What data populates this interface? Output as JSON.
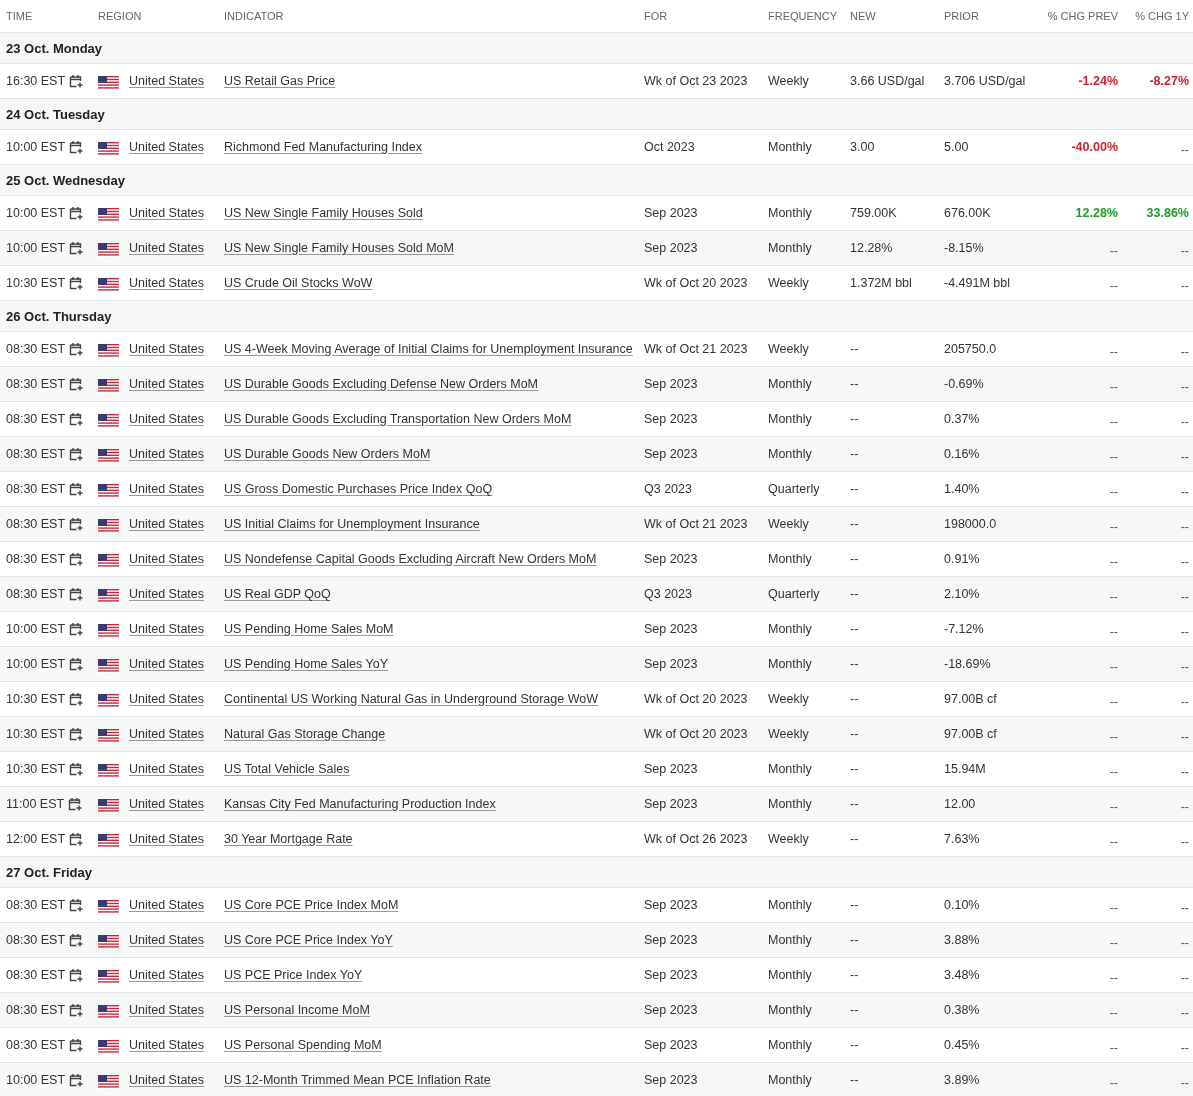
{
  "columns": [
    "TIME",
    "REGION",
    "INDICATOR",
    "FOR",
    "FREQUENCY",
    "NEW",
    "PRIOR",
    "% CHG PREV",
    "% CHG 1Y"
  ],
  "days": [
    {
      "label": "23 Oct. Monday",
      "events": [
        {
          "time": "16:30 EST",
          "region": "United States",
          "indicator": "US Retail Gas Price",
          "for": "Wk of Oct 23 2023",
          "frequency": "Weekly",
          "new": "3.66 USD/gal",
          "prior": "3.706 USD/gal",
          "chg_prev": {
            "text": "-1.24%",
            "color": "#d0202e"
          },
          "chg_1y": {
            "text": "-8.27%",
            "color": "#d0202e"
          }
        }
      ]
    },
    {
      "label": "24 Oct. Tuesday",
      "events": [
        {
          "time": "10:00 EST",
          "region": "United States",
          "indicator": "Richmond Fed Manufacturing Index",
          "for": "Oct 2023",
          "frequency": "Monthly",
          "new": "3.00",
          "prior": "5.00",
          "chg_prev": {
            "text": "-40.00%",
            "color": "#d0202e"
          },
          "chg_1y": {
            "text": "--"
          }
        }
      ]
    },
    {
      "label": "25 Oct. Wednesday",
      "events": [
        {
          "time": "10:00 EST",
          "region": "United States",
          "indicator": "US New Single Family Houses Sold",
          "for": "Sep 2023",
          "frequency": "Monthly",
          "new": "759.00K",
          "prior": "676.00K",
          "chg_prev": {
            "text": "12.28%",
            "color": "#1f9d2a"
          },
          "chg_1y": {
            "text": "33.86%",
            "color": "#1f9d2a"
          }
        },
        {
          "time": "10:00 EST",
          "region": "United States",
          "indicator": "US New Single Family Houses Sold MoM",
          "for": "Sep 2023",
          "frequency": "Monthly",
          "new": "12.28%",
          "prior": "-8.15%",
          "chg_prev": {
            "text": "--"
          },
          "chg_1y": {
            "text": "--"
          }
        },
        {
          "time": "10:30 EST",
          "region": "United States",
          "indicator": "US Crude Oil Stocks WoW",
          "for": "Wk of Oct 20 2023",
          "frequency": "Weekly",
          "new": "1.372M bbl",
          "prior": "-4.491M bbl",
          "chg_prev": {
            "text": "--"
          },
          "chg_1y": {
            "text": "--"
          }
        }
      ]
    },
    {
      "label": "26 Oct. Thursday",
      "events": [
        {
          "time": "08:30 EST",
          "region": "United States",
          "indicator": "US 4-Week Moving Average of Initial Claims for Unemployment Insurance",
          "for": "Wk of Oct 21 2023",
          "frequency": "Weekly",
          "new": "--",
          "prior": "205750.0",
          "chg_prev": {
            "text": "--"
          },
          "chg_1y": {
            "text": "--"
          }
        },
        {
          "time": "08:30 EST",
          "region": "United States",
          "indicator": "US Durable Goods Excluding Defense New Orders MoM",
          "for": "Sep 2023",
          "frequency": "Monthly",
          "new": "--",
          "prior": "-0.69%",
          "chg_prev": {
            "text": "--"
          },
          "chg_1y": {
            "text": "--"
          }
        },
        {
          "time": "08:30 EST",
          "region": "United States",
          "indicator": "US Durable Goods Excluding Transportation New Orders MoM",
          "for": "Sep 2023",
          "frequency": "Monthly",
          "new": "--",
          "prior": "0.37%",
          "chg_prev": {
            "text": "--"
          },
          "chg_1y": {
            "text": "--"
          }
        },
        {
          "time": "08:30 EST",
          "region": "United States",
          "indicator": "US Durable Goods New Orders MoM",
          "for": "Sep 2023",
          "frequency": "Monthly",
          "new": "--",
          "prior": "0.16%",
          "chg_prev": {
            "text": "--"
          },
          "chg_1y": {
            "text": "--"
          }
        },
        {
          "time": "08:30 EST",
          "region": "United States",
          "indicator": "US Gross Domestic Purchases Price Index QoQ",
          "for": "Q3 2023",
          "frequency": "Quarterly",
          "new": "--",
          "prior": "1.40%",
          "chg_prev": {
            "text": "--"
          },
          "chg_1y": {
            "text": "--"
          }
        },
        {
          "time": "08:30 EST",
          "region": "United States",
          "indicator": "US Initial Claims for Unemployment Insurance",
          "for": "Wk of Oct 21 2023",
          "frequency": "Weekly",
          "new": "--",
          "prior": "198000.0",
          "chg_prev": {
            "text": "--"
          },
          "chg_1y": {
            "text": "--"
          }
        },
        {
          "time": "08:30 EST",
          "region": "United States",
          "indicator": "US Nondefense Capital Goods Excluding Aircraft New Orders MoM",
          "for": "Sep 2023",
          "frequency": "Monthly",
          "new": "--",
          "prior": "0.91%",
          "chg_prev": {
            "text": "--"
          },
          "chg_1y": {
            "text": "--"
          }
        },
        {
          "time": "08:30 EST",
          "region": "United States",
          "indicator": "US Real GDP QoQ",
          "for": "Q3 2023",
          "frequency": "Quarterly",
          "new": "--",
          "prior": "2.10%",
          "chg_prev": {
            "text": "--"
          },
          "chg_1y": {
            "text": "--"
          }
        },
        {
          "time": "10:00 EST",
          "region": "United States",
          "indicator": "US Pending Home Sales MoM",
          "for": "Sep 2023",
          "frequency": "Monthly",
          "new": "--",
          "prior": "-7.12%",
          "chg_prev": {
            "text": "--"
          },
          "chg_1y": {
            "text": "--"
          }
        },
        {
          "time": "10:00 EST",
          "region": "United States",
          "indicator": "US Pending Home Sales YoY",
          "for": "Sep 2023",
          "frequency": "Monthly",
          "new": "--",
          "prior": "-18.69%",
          "chg_prev": {
            "text": "--"
          },
          "chg_1y": {
            "text": "--"
          }
        },
        {
          "time": "10:30 EST",
          "region": "United States",
          "indicator": "Continental US Working Natural Gas in Underground Storage WoW",
          "for": "Wk of Oct 20 2023",
          "frequency": "Weekly",
          "new": "--",
          "prior": "97.00B cf",
          "chg_prev": {
            "text": "--"
          },
          "chg_1y": {
            "text": "--"
          }
        },
        {
          "time": "10:30 EST",
          "region": "United States",
          "indicator": "Natural Gas Storage Change",
          "for": "Wk of Oct 20 2023",
          "frequency": "Weekly",
          "new": "--",
          "prior": "97.00B cf",
          "chg_prev": {
            "text": "--"
          },
          "chg_1y": {
            "text": "--"
          }
        },
        {
          "time": "10:30 EST",
          "region": "United States",
          "indicator": "US Total Vehicle Sales",
          "for": "Sep 2023",
          "frequency": "Monthly",
          "new": "--",
          "prior": "15.94M",
          "chg_prev": {
            "text": "--"
          },
          "chg_1y": {
            "text": "--"
          }
        },
        {
          "time": "11:00 EST",
          "region": "United States",
          "indicator": "Kansas City Fed Manufacturing Production Index",
          "for": "Sep 2023",
          "frequency": "Monthly",
          "new": "--",
          "prior": "12.00",
          "chg_prev": {
            "text": "--"
          },
          "chg_1y": {
            "text": "--"
          }
        },
        {
          "time": "12:00 EST",
          "region": "United States",
          "indicator": "30 Year Mortgage Rate",
          "for": "Wk of Oct 26 2023",
          "frequency": "Weekly",
          "new": "--",
          "prior": "7.63%",
          "chg_prev": {
            "text": "--"
          },
          "chg_1y": {
            "text": "--"
          }
        }
      ]
    },
    {
      "label": "27 Oct. Friday",
      "events": [
        {
          "time": "08:30 EST",
          "region": "United States",
          "indicator": "US Core PCE Price Index MoM",
          "for": "Sep 2023",
          "frequency": "Monthly",
          "new": "--",
          "prior": "0.10%",
          "chg_prev": {
            "text": "--"
          },
          "chg_1y": {
            "text": "--"
          }
        },
        {
          "time": "08:30 EST",
          "region": "United States",
          "indicator": "US Core PCE Price Index YoY",
          "for": "Sep 2023",
          "frequency": "Monthly",
          "new": "--",
          "prior": "3.88%",
          "chg_prev": {
            "text": "--"
          },
          "chg_1y": {
            "text": "--"
          }
        },
        {
          "time": "08:30 EST",
          "region": "United States",
          "indicator": "US PCE Price Index YoY",
          "for": "Sep 2023",
          "frequency": "Monthly",
          "new": "--",
          "prior": "3.48%",
          "chg_prev": {
            "text": "--"
          },
          "chg_1y": {
            "text": "--"
          }
        },
        {
          "time": "08:30 EST",
          "region": "United States",
          "indicator": "US Personal Income MoM",
          "for": "Sep 2023",
          "frequency": "Monthly",
          "new": "--",
          "prior": "0.38%",
          "chg_prev": {
            "text": "--"
          },
          "chg_1y": {
            "text": "--"
          }
        },
        {
          "time": "08:30 EST",
          "region": "United States",
          "indicator": "US Personal Spending MoM",
          "for": "Sep 2023",
          "frequency": "Monthly",
          "new": "--",
          "prior": "0.45%",
          "chg_prev": {
            "text": "--"
          },
          "chg_1y": {
            "text": "--"
          }
        },
        {
          "time": "10:00 EST",
          "region": "United States",
          "indicator": "US 12-Month Trimmed Mean PCE Inflation Rate",
          "for": "Sep 2023",
          "frequency": "Monthly",
          "new": "--",
          "prior": "3.89%",
          "chg_prev": {
            "text": "--"
          },
          "chg_1y": {
            "text": "--"
          }
        }
      ]
    }
  ]
}
